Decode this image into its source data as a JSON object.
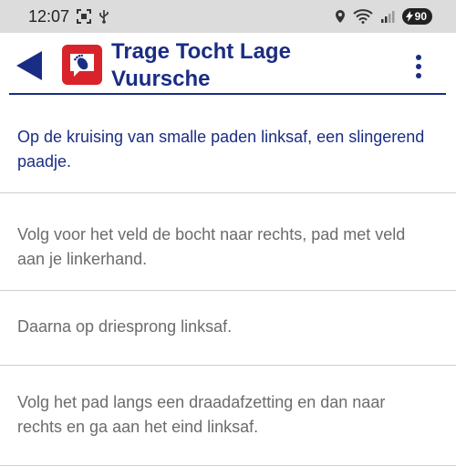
{
  "status_bar": {
    "time": "12:07",
    "battery_level": "90",
    "icons_left": [
      "screenshot-icon",
      "usb-icon"
    ],
    "icons_right": [
      "location-icon",
      "wifi-icon",
      "signal-icon",
      "battery-icon"
    ]
  },
  "app_bar": {
    "title": "Trage Tocht Lage Vuursche",
    "back_icon": "back-arrow-icon",
    "logo_icon": "footprint-logo-icon",
    "menu_icon": "more-vertical-icon",
    "accent_color": "#1a2d84",
    "logo_color": "#d8232a"
  },
  "route_steps": [
    {
      "text": "Op de kruising van smalle paden linksaf, een slingerend paadje.",
      "active": true
    },
    {
      "text": "Volg voor het veld de bocht naar rechts, pad met veld aan je linkerhand.",
      "active": false
    },
    {
      "text": "Daarna op driesprong linksaf.",
      "active": false
    },
    {
      "text": "Volg het pad langs een draadafzetting en dan naar rechts en ga aan het eind linksaf.",
      "active": false
    }
  ]
}
